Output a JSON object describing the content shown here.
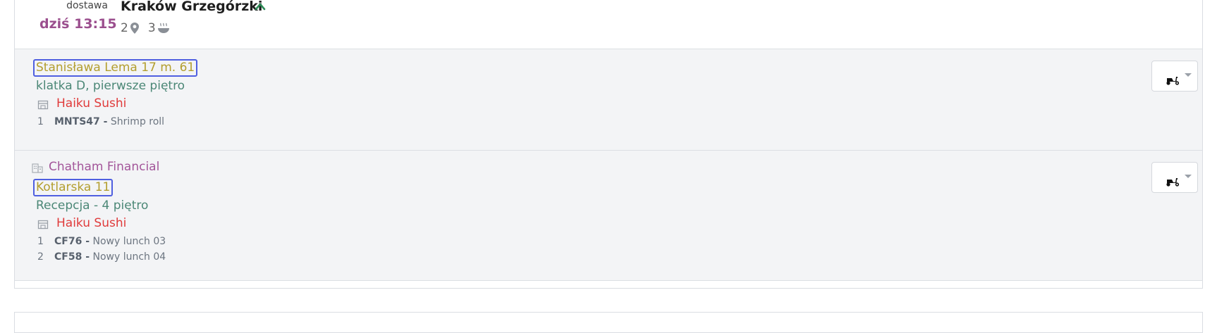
{
  "header": {
    "delivery_label": "dostawa",
    "time": "dziś 13:15",
    "title": "Kraków Grzegórzki",
    "locations_count": "2",
    "meals_count": "3"
  },
  "orders": [
    {
      "address": "Stanisława Lema 17 m. 61",
      "note": "klatka D, pierwsze piętro",
      "restaurant": "Haiku Sushi",
      "items": [
        {
          "qty": "1",
          "code": "MNTS47 -",
          "name": " Shrimp roll"
        }
      ]
    },
    {
      "company": "Chatham Financial",
      "address": "Kotlarska 11",
      "note": "Recepcja - 4 piętro",
      "restaurant": "Haiku Sushi",
      "items": [
        {
          "qty": "1",
          "code": "CF76 -",
          "name": " Nowy lunch 03"
        },
        {
          "qty": "2",
          "code": "CF58 -",
          "name": " Nowy lunch 04"
        }
      ]
    }
  ],
  "icons": {
    "chevron": "chevron-up-icon",
    "location": "map-pin-icon",
    "meal": "bowl-icon",
    "restaurant": "store-icon",
    "company": "building-icon",
    "courier": "scooter-icon"
  },
  "colors": {
    "time": "#9b4f8e",
    "address": "#b39e2e",
    "address_border": "#4f5fe0",
    "note": "#4b8776",
    "company": "#a3569a",
    "restaurant": "#e03b3b",
    "chevron": "#2e8b57"
  }
}
